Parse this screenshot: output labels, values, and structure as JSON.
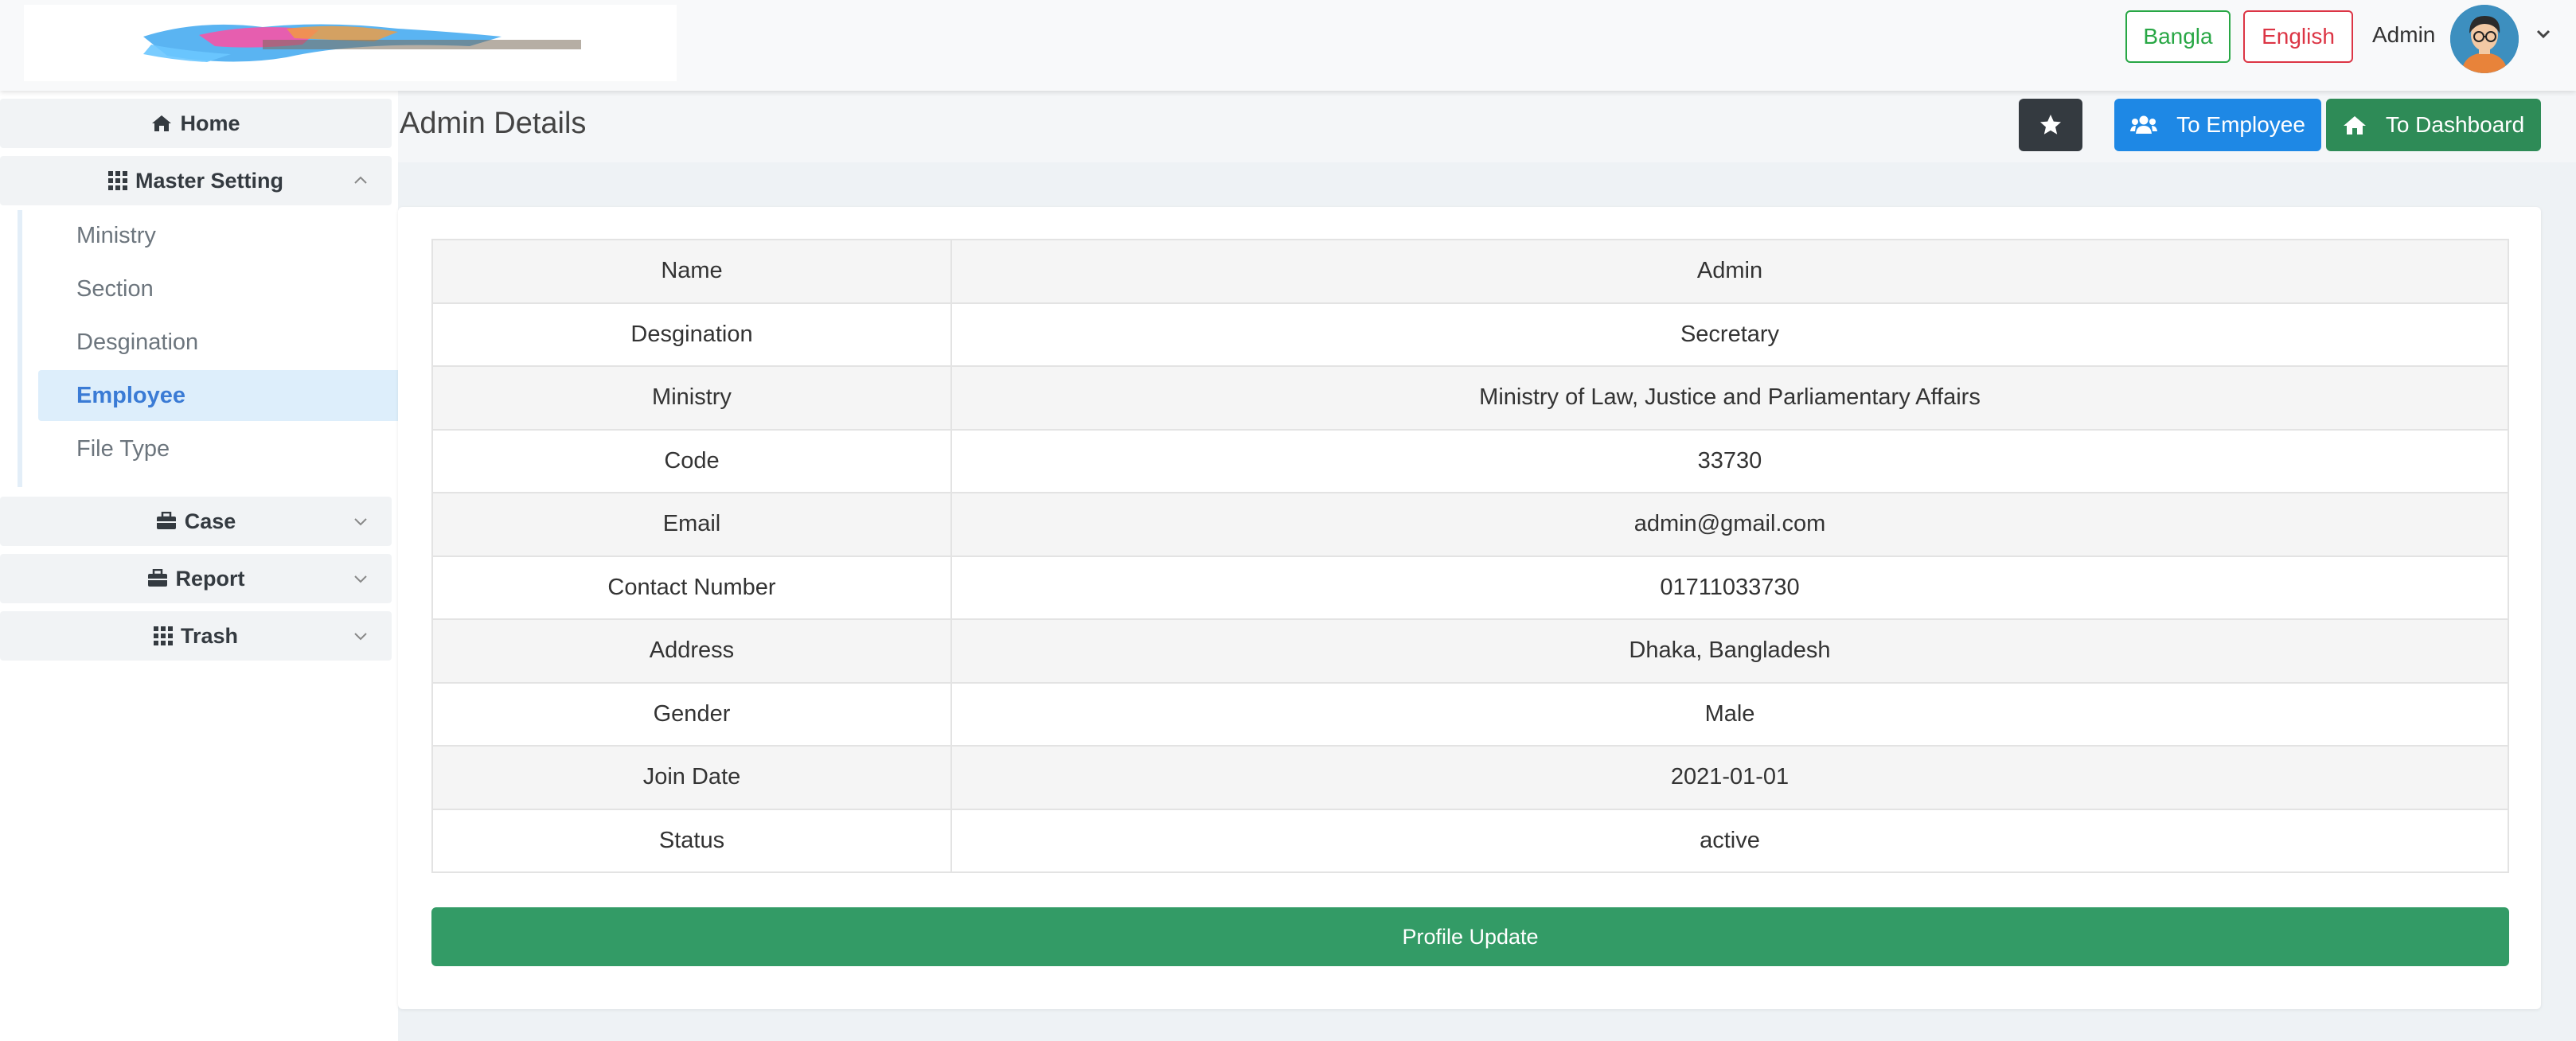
{
  "header": {
    "language_buttons": {
      "bangla": "Bangla",
      "english": "English"
    },
    "user_name": "Admin",
    "icons": {
      "avatar": "user-avatar-icon",
      "caret": "chevron-down-icon"
    }
  },
  "sidebar": {
    "home": {
      "label": "Home",
      "icon": "home-icon"
    },
    "master_setting": {
      "label": "Master Setting",
      "icon": "grid-icon",
      "expanded": true,
      "items": [
        {
          "label": "Ministry",
          "active": false
        },
        {
          "label": "Section",
          "active": false
        },
        {
          "label": "Desgination",
          "active": false
        },
        {
          "label": "Employee",
          "active": true
        },
        {
          "label": "File Type",
          "active": false
        }
      ]
    },
    "case": {
      "label": "Case",
      "icon": "briefcase-icon"
    },
    "report": {
      "label": "Report",
      "icon": "briefcase-icon"
    },
    "trash": {
      "label": "Trash",
      "icon": "grid-icon"
    }
  },
  "main": {
    "title": "Admin Details",
    "actions": {
      "star_icon": "star-icon",
      "to_employee": "To Employee",
      "to_dashboard": "To Dashboard"
    },
    "details": [
      {
        "key": "Name",
        "value": "Admin"
      },
      {
        "key": "Desgination",
        "value": "Secretary"
      },
      {
        "key": "Ministry",
        "value": "Ministry of Law, Justice and Parliamentary Affairs"
      },
      {
        "key": "Code",
        "value": "33730"
      },
      {
        "key": "Email",
        "value": "admin@gmail.com"
      },
      {
        "key": "Contact Number",
        "value": "01711033730"
      },
      {
        "key": "Address",
        "value": "Dhaka, Bangladesh"
      },
      {
        "key": "Gender",
        "value": "Male"
      },
      {
        "key": "Join Date",
        "value": "2021-01-01"
      },
      {
        "key": "Status",
        "value": "active"
      }
    ],
    "update_button": "Profile Update"
  },
  "colors": {
    "bangla": "#28a745",
    "english": "#dc3545",
    "to_employee": "#1e88e5",
    "to_dashboard": "#2e8b57",
    "profile_update": "#339b66",
    "active_menu": "#3a7bd5"
  }
}
